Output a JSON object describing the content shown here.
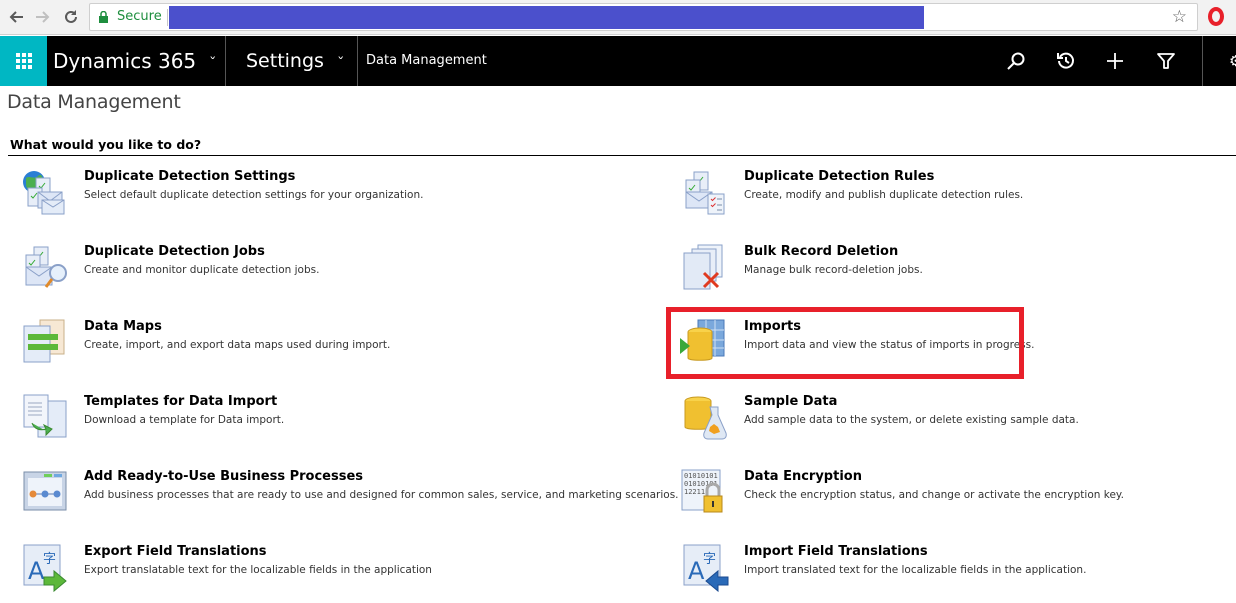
{
  "browser": {
    "secure_label": "Secure",
    "url": "",
    "icons": [
      "back-arrow-icon",
      "forward-arrow-icon",
      "reload-icon",
      "lock-icon",
      "bookmark-star-icon",
      "opera-icon"
    ]
  },
  "navbar": {
    "app_name": "Dynamics 365",
    "area_name": "Settings",
    "breadcrumb": "Data Management",
    "accent_color": "#00b7c3",
    "icons": [
      "search-icon",
      "recent-history-icon",
      "create-plus-icon",
      "advanced-find-filter-icon"
    ]
  },
  "page": {
    "title": "Data Management",
    "section_heading": "What would you like to do?"
  },
  "tiles": [
    {
      "title": "Duplicate Detection Settings",
      "desc": "Select default duplicate detection settings for your organization.",
      "icon": "duplicate-detection-settings-icon"
    },
    {
      "title": "Duplicate Detection Rules",
      "desc": "Create, modify and publish duplicate detection rules.",
      "icon": "duplicate-detection-rules-icon"
    },
    {
      "title": "Duplicate Detection Jobs",
      "desc": "Create and monitor duplicate detection jobs.",
      "icon": "duplicate-detection-jobs-icon"
    },
    {
      "title": "Bulk Record Deletion",
      "desc": "Manage bulk record-deletion jobs.",
      "icon": "bulk-delete-icon"
    },
    {
      "title": "Data Maps",
      "desc": "Create, import, and export data maps used during import.",
      "icon": "data-maps-icon"
    },
    {
      "title": "Imports",
      "desc": "Import data and view the status of imports in progress.",
      "icon": "imports-icon",
      "highlighted": true
    },
    {
      "title": "Templates for Data Import",
      "desc": "Download a template for Data import.",
      "icon": "templates-icon"
    },
    {
      "title": "Sample Data",
      "desc": "Add sample data to the system, or delete existing sample data.",
      "icon": "sample-data-icon"
    },
    {
      "title": "Add Ready-to-Use Business Processes",
      "desc": "Add business processes that are ready to use and designed for common sales, service, and marketing scenarios.",
      "icon": "business-processes-icon"
    },
    {
      "title": "Data Encryption",
      "desc": "Check the encryption status, and change or activate the encryption key.",
      "icon": "data-encryption-icon"
    },
    {
      "title": "Export Field Translations",
      "desc": "Export translatable text for the localizable fields in the application",
      "icon": "export-translations-icon"
    },
    {
      "title": "Import Field Translations",
      "desc": "Import translated text for the localizable fields in the application.",
      "icon": "import-translations-icon"
    }
  ],
  "highlight": {
    "target": "Imports",
    "color": "#e8202a"
  }
}
